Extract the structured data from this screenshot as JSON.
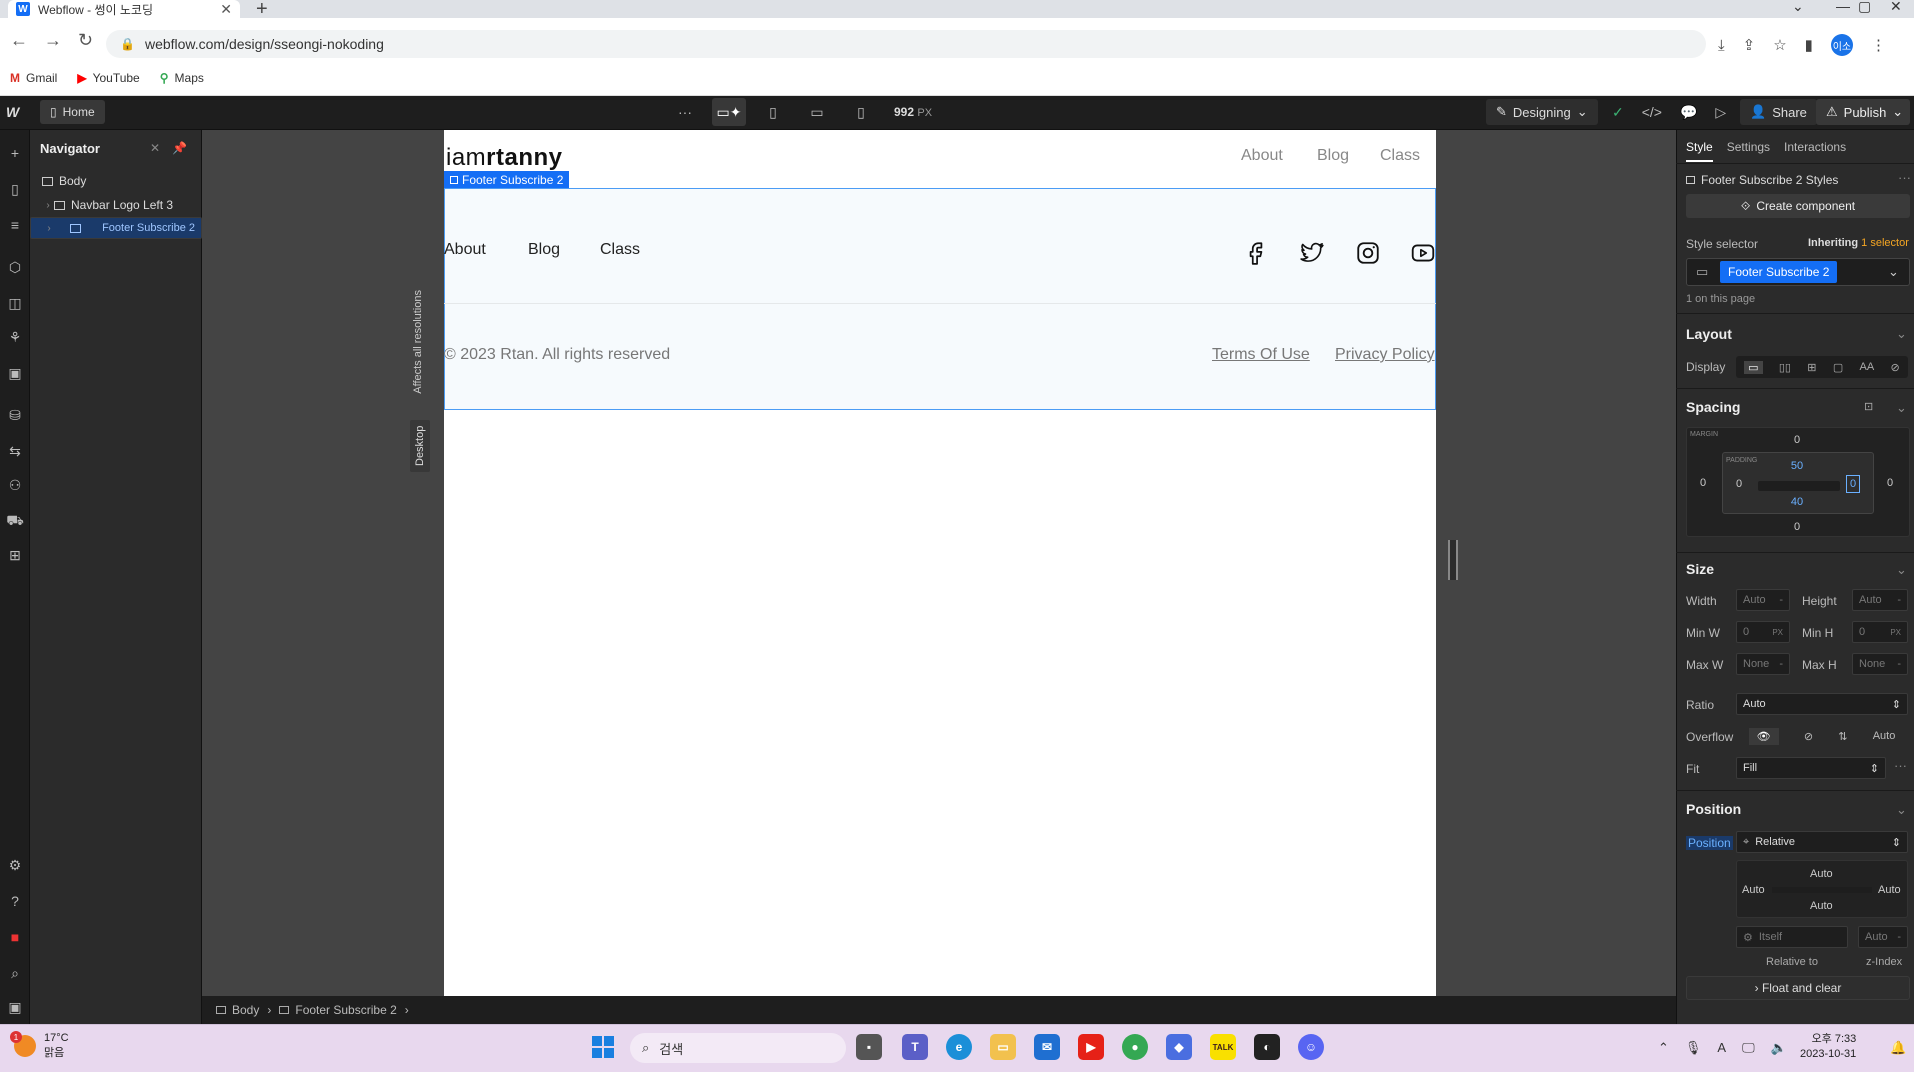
{
  "browser": {
    "tab_title": "Webflow - 썽이 노코딩",
    "url": "webflow.com/design/sseongi-nokoding",
    "bookmarks": [
      "Gmail",
      "YouTube",
      "Maps"
    ],
    "profile_initials": "이소"
  },
  "webflow": {
    "home_label": "Home",
    "breakpoint_width": "992",
    "breakpoint_unit": "PX",
    "mode_label": "Designing",
    "share_label": "Share",
    "publish_label": "Publish"
  },
  "navigator": {
    "title": "Navigator",
    "items": [
      {
        "label": "Body"
      },
      {
        "label": "Navbar Logo Left 3"
      },
      {
        "label": "Footer Subscribe 2"
      }
    ]
  },
  "canvas": {
    "side_label_resolutions": "Affects all resolutions",
    "side_label_desktop": "Desktop",
    "logo_light": "iam",
    "logo_bold": "rtanny",
    "top_nav": [
      "About",
      "Blog",
      "Class"
    ],
    "selection_badge": "Footer Subscribe 2",
    "footer_nav": [
      "About",
      "Blog",
      "Class"
    ],
    "copyright": "© 2023 Rtan. All rights reserved",
    "footer_links": [
      "Terms Of Use",
      "Privacy Policy"
    ]
  },
  "breadcrumb": [
    "Body",
    "Footer Subscribe 2"
  ],
  "style_panel": {
    "tabs": [
      "Style",
      "Settings",
      "Interactions"
    ],
    "element_styles": "Footer Subscribe 2 Styles",
    "create_component": "Create component",
    "style_selector_label": "Style selector",
    "inheriting_label": "Inheriting",
    "inheriting_count": "1 selector",
    "selector_chip": "Footer Subscribe 2",
    "on_page": "1 on this page",
    "layout": {
      "heading": "Layout",
      "display_label": "Display",
      "display_options": [
        "▭",
        "▯▯",
        "⊞",
        "▢",
        "AA",
        "⊘"
      ]
    },
    "spacing": {
      "heading": "Spacing",
      "margin_label": "MARGIN",
      "padding_label": "PADDING",
      "margin_top": "0",
      "margin_right": "0",
      "margin_bottom": "0",
      "margin_left": "0",
      "padding_top": "50",
      "padding_right": "0",
      "padding_bottom": "40",
      "padding_left": "0"
    },
    "size": {
      "heading": "Size",
      "width_label": "Width",
      "width_value": "Auto",
      "height_label": "Height",
      "height_value": "Auto",
      "minw_label": "Min W",
      "minw_value": "0",
      "minw_unit": "PX",
      "minh_label": "Min H",
      "minh_value": "0",
      "minh_unit": "PX",
      "maxw_label": "Max W",
      "maxw_value": "None",
      "maxh_label": "Max H",
      "maxh_value": "None",
      "ratio_label": "Ratio",
      "ratio_value": "Auto",
      "overflow_label": "Overflow",
      "overflow_auto": "Auto",
      "fit_label": "Fit",
      "fit_value": "Fill"
    },
    "position": {
      "heading": "Position",
      "position_label": "Position",
      "position_value": "Relative",
      "top": "Auto",
      "left": "Auto",
      "right": "Auto",
      "bottom": "Auto",
      "relative_to_value": "Itself",
      "relative_to_label": "Relative to",
      "zindex_value": "Auto",
      "zindex_label": "z-Index"
    },
    "float_clear": "Float and clear"
  },
  "taskbar": {
    "temperature": "17°C",
    "weather": "맑음",
    "weather_alert": "1",
    "search_placeholder": "검색",
    "time": "오후 7:33",
    "date": "2023-10-31"
  },
  "colors": {
    "accent": "#146ef5",
    "editor_bg": "#2b2b2b",
    "footer_bg": "#f6fafd"
  }
}
